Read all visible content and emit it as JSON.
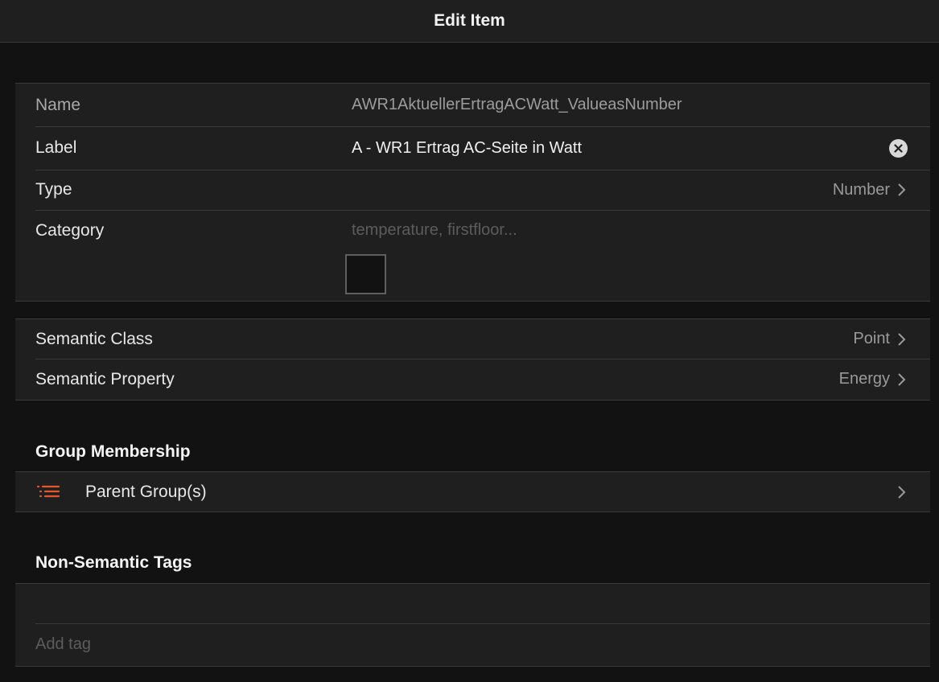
{
  "navbar": {
    "title": "Edit Item"
  },
  "item": {
    "name": {
      "label": "Name",
      "value": "AWR1AktuellerErtragACWatt_ValueasNumber"
    },
    "label": {
      "label": "Label",
      "value": "A - WR1 Ertrag AC-Seite in Watt"
    },
    "type": {
      "label": "Type",
      "value": "Number"
    },
    "category": {
      "label": "Category",
      "placeholder": "temperature, firstfloor..."
    }
  },
  "semantics": {
    "class": {
      "label": "Semantic Class",
      "value": "Point"
    },
    "property": {
      "label": "Semantic Property",
      "value": "Energy"
    }
  },
  "groups": {
    "title": "Group Membership",
    "parent_label": "Parent Group(s)"
  },
  "tags": {
    "title": "Non-Semantic Tags",
    "add_placeholder": "Add tag"
  },
  "colors": {
    "accent": "#e8552a",
    "background": "#121212",
    "card": "#1f1f1f"
  },
  "icons": {
    "group": "list-icon",
    "chevron": "chevron-right-icon",
    "clear": "clear-circle-icon"
  }
}
